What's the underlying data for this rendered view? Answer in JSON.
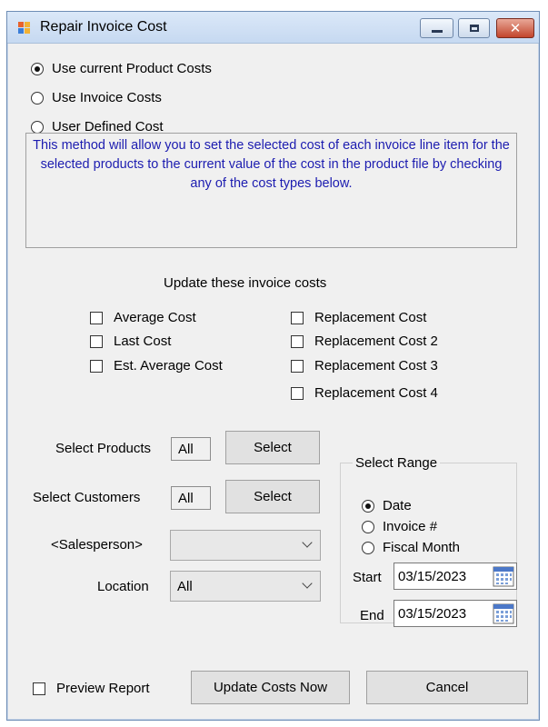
{
  "window": {
    "title": "Repair Invoice Cost",
    "minimize_label": "Minimize",
    "maximize_label": "Maximize",
    "close_label": "Close"
  },
  "method": {
    "options": [
      "Use current Product Costs",
      "Use Invoice Costs",
      "User Defined Cost"
    ],
    "selected": 0,
    "description": "This method will allow you to set the selected cost of each invoice line item for the selected products to the current value of the cost in the product file by checking any of the cost types below."
  },
  "update_costs": {
    "heading": "Update these invoice costs",
    "left": [
      {
        "label": "Average Cost",
        "checked": false
      },
      {
        "label": "Last Cost",
        "checked": false
      },
      {
        "label": "Est. Average Cost",
        "checked": false
      }
    ],
    "right": [
      {
        "label": "Replacement Cost",
        "checked": false
      },
      {
        "label": "Replacement Cost 2",
        "checked": false
      },
      {
        "label": "Replacement Cost 3",
        "checked": false
      },
      {
        "label": "Replacement Cost 4",
        "checked": false
      }
    ]
  },
  "filters": {
    "products_label": "Select Products",
    "products_value": "All",
    "customers_label": "Select Customers",
    "customers_value": "All",
    "select_button": "Select",
    "salesperson_label": "<Salesperson>",
    "salesperson_value": "",
    "location_label": "Location",
    "location_value": "All"
  },
  "range": {
    "title": "Select Range",
    "options": [
      "Date",
      "Invoice #",
      "Fiscal Month"
    ],
    "selected": 0,
    "start_label": "Start",
    "start_value": "03/15/2023",
    "end_label": "End",
    "end_value": "03/15/2023"
  },
  "footer": {
    "preview_label": "Preview Report",
    "preview_checked": false,
    "update_button": "Update Costs Now",
    "cancel_button": "Cancel"
  },
  "colors": {
    "description_text": "#1c1cb0",
    "title_bar": "#c6d9f1",
    "close_button": "#c2452c"
  }
}
